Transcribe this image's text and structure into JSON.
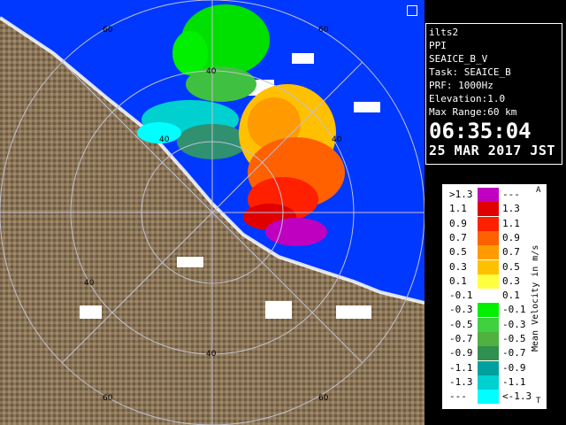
{
  "info": {
    "radar": "ilts2",
    "product": "PPI",
    "field": "SEAICE_B_V",
    "task": "Task: SEAICE_B",
    "prf": "PRF: 1000Hz",
    "elevation": "Elevation:1.0",
    "max_range": "Max Range:60 km",
    "time": "06:35:04",
    "date": "25 MAR 2017 JST"
  },
  "range_ring_labels": [
    "60",
    "40",
    "40",
    "40",
    "40",
    "40",
    "60",
    "60",
    "60"
  ],
  "legend": {
    "unit_label": "Mean Velocity in m/s",
    "corner_top": "A",
    "corner_bottom": "T",
    "rows": [
      {
        "lo": ">1.3",
        "hi": "---",
        "color": "#c000c0"
      },
      {
        "lo": "1.1",
        "hi": "1.3",
        "color": "#e00000"
      },
      {
        "lo": "0.9",
        "hi": "1.1",
        "color": "#ff2000"
      },
      {
        "lo": "0.7",
        "hi": "0.9",
        "color": "#ff6000"
      },
      {
        "lo": "0.5",
        "hi": "0.7",
        "color": "#ff9a00"
      },
      {
        "lo": "0.3",
        "hi": "0.5",
        "color": "#ffc000"
      },
      {
        "lo": "0.1",
        "hi": "0.3",
        "color": "#ffff40"
      },
      {
        "lo": "-0.1",
        "hi": "0.1",
        "color": "#ffffff"
      },
      {
        "lo": "-0.3",
        "hi": "-0.1",
        "color": "#00f000"
      },
      {
        "lo": "-0.5",
        "hi": "-0.3",
        "color": "#40d040"
      },
      {
        "lo": "-0.7",
        "hi": "-0.5",
        "color": "#50b040"
      },
      {
        "lo": "-0.9",
        "hi": "-0.7",
        "color": "#309050"
      },
      {
        "lo": "-1.1",
        "hi": "-0.9",
        "color": "#00a0a0"
      },
      {
        "lo": "-1.3",
        "hi": "-1.1",
        "color": "#00d0d0"
      },
      {
        "lo": "---",
        "hi": "<-1.3",
        "color": "#00ffff"
      }
    ]
  },
  "colors": {
    "sea_blue": "#0038ff",
    "terrain": "#8a7558",
    "ring": "#b0b0c0"
  }
}
